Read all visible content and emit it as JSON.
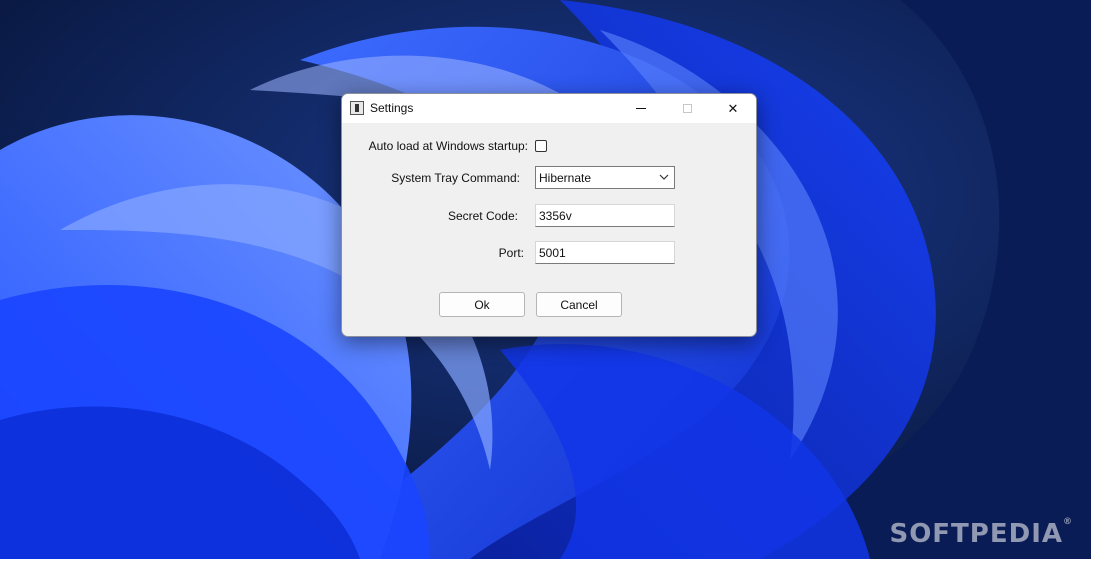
{
  "dialog": {
    "title": "Settings",
    "fields": {
      "autoload_label": "Auto load at Windows startup:",
      "autoload_checked": false,
      "tray_label": "System Tray Command:",
      "tray_value": "Hibernate",
      "secret_label": "Secret Code:",
      "secret_value": "3356v",
      "port_label": "Port:",
      "port_value": "5001"
    },
    "buttons": {
      "ok": "Ok",
      "cancel": "Cancel"
    }
  },
  "titlebar_controls": {
    "close_glyph": "✕"
  },
  "watermark": {
    "text": "SOFTPEDIA",
    "mark": "®"
  },
  "colors": {
    "wallpaper_dark": "#0a1a44",
    "wallpaper_blue": "#1a3fe0",
    "dialog_bg": "#f0f0f0"
  },
  "icons": {
    "app": "app-icon",
    "minimize": "minimize-icon",
    "maximize": "maximize-icon",
    "close": "close-icon",
    "dropdown": "chevron-down-icon"
  }
}
